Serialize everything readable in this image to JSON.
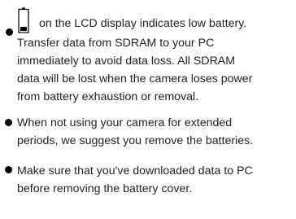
{
  "notes": [
    {
      "lines": [
        "on the LCD display indicates low battery.",
        "Transfer data from SDRAM to your PC",
        "immediately to avoid data loss. All SDRAM",
        "data will be lost when the camera loses power",
        "from battery exhaustion or removal."
      ],
      "icon": "low-battery-icon"
    },
    {
      "lines": [
        "When not using your camera for extended",
        "periods, we suggest you remove the batteries."
      ]
    },
    {
      "lines": [
        "Make sure that you've downloaded data to PC",
        "before removing the battery cover."
      ]
    }
  ]
}
